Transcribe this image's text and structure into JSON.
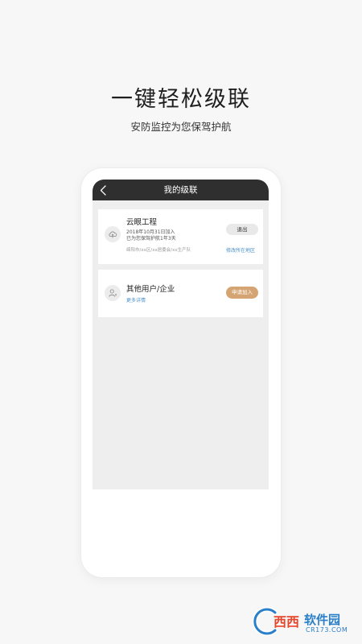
{
  "headline": "一键轻松级联",
  "subline": "安防监控为您保驾护航",
  "phone": {
    "title": "我的级联",
    "cards": [
      {
        "icon": "cloud-icon",
        "title": "云眼工程",
        "joined": "2018年10月31日加入",
        "protected": "已为您保驾护航1年3天",
        "location": "绵阳市/xx区/xx居委会/xx生产队",
        "exit_label": "退出",
        "modify_label": "修改所在地区"
      },
      {
        "icon": "user-icon",
        "title": "其他用户/企业",
        "more_label": "更多详情",
        "apply_label": "申请加入"
      }
    ]
  },
  "watermark": {
    "primary": "西西",
    "secondary": "软件园",
    "domain": "CR173.COM"
  },
  "colors": {
    "titlebar": "#2f2f2f",
    "accent": "#d4a473",
    "link": "#4a90c8",
    "content_bg": "#eeeeee"
  }
}
